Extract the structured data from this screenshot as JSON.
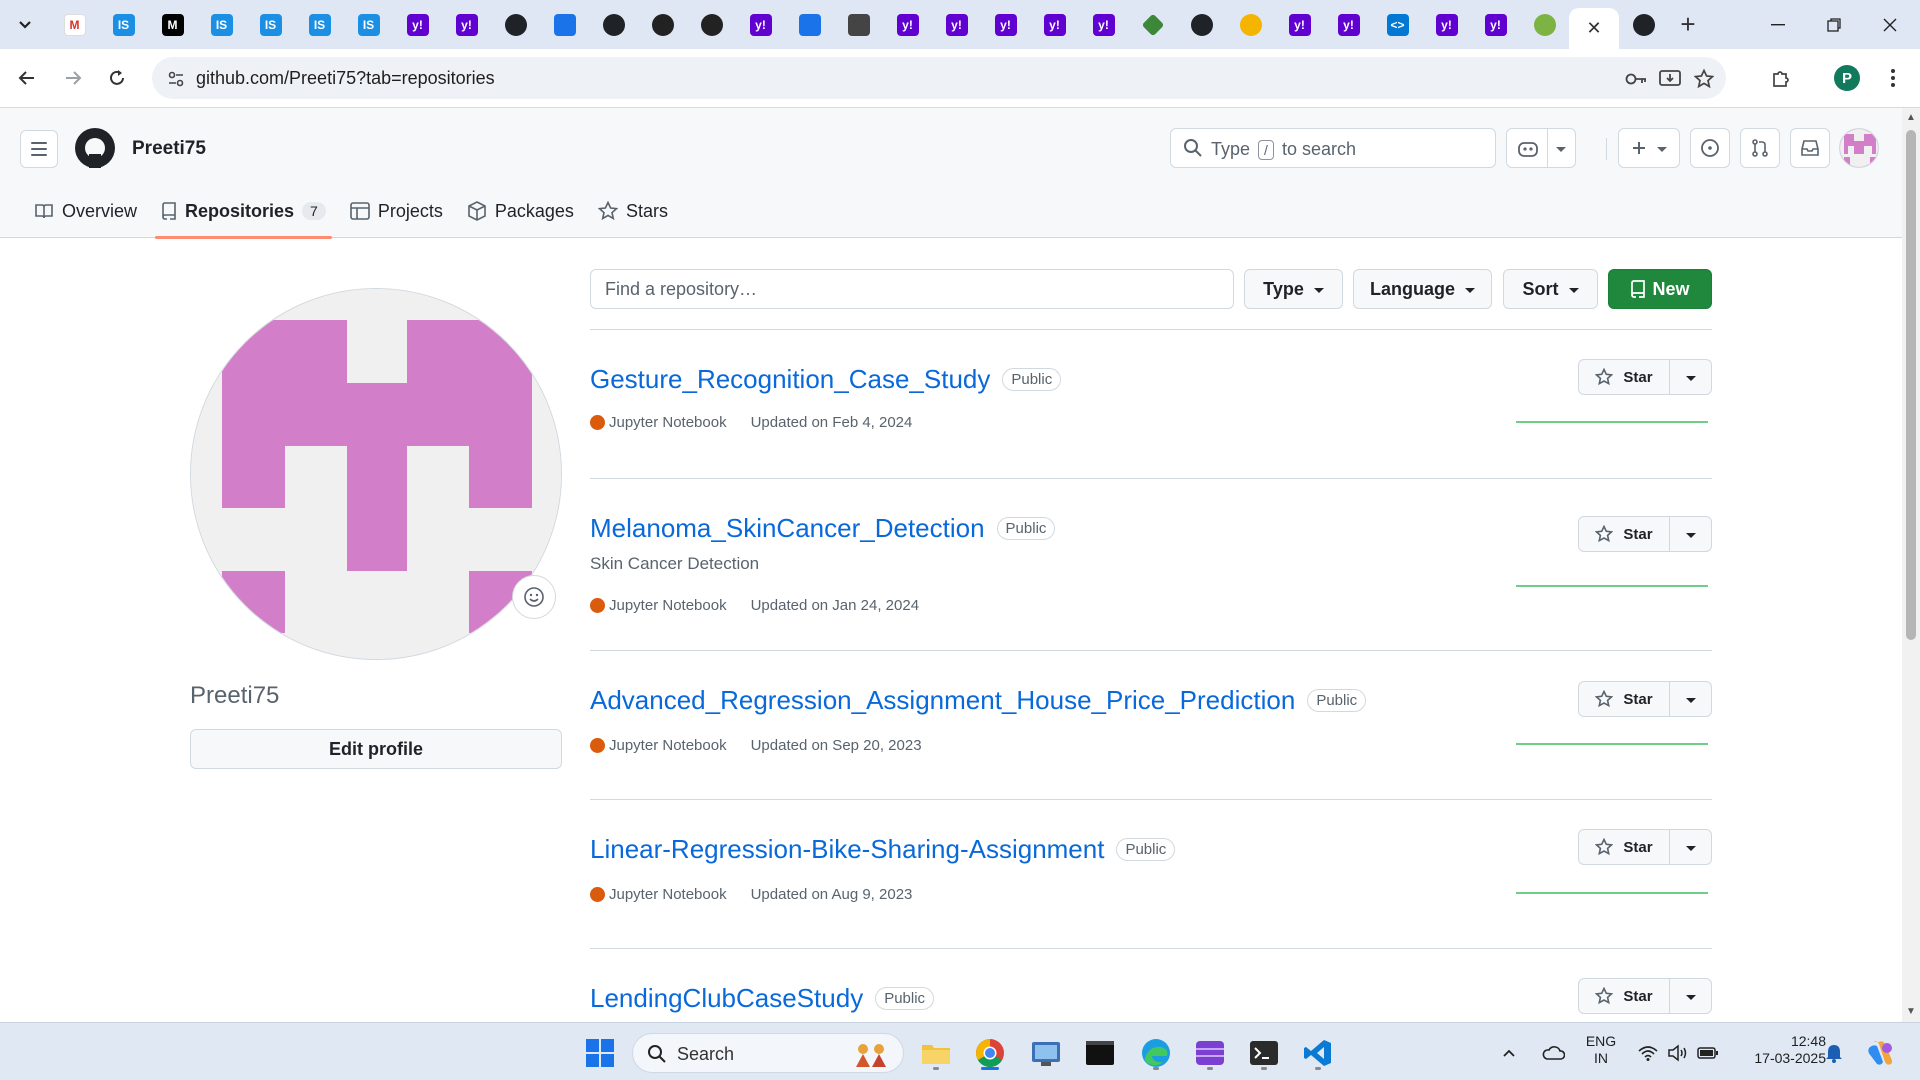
{
  "browser": {
    "url": "github.com/Preeti75?tab=repositories",
    "active_tab_close": "✕",
    "new_tab": "+",
    "tab_favicons": [
      "gmail-icon",
      "is-icon",
      "medium-icon",
      "is-icon",
      "is-icon",
      "is-icon",
      "is-icon",
      "yahoo-icon",
      "yahoo-icon",
      "github-icon",
      "calendar-icon",
      "github-icon",
      "openai-icon",
      "openai-icon",
      "yahoo-icon",
      "calendar-icon",
      "perplexity-icon",
      "yahoo-icon",
      "yahoo-icon",
      "yahoo-icon",
      "yahoo-icon",
      "yahoo-icon",
      "node-icon",
      "github-icon",
      "bulb-icon",
      "yahoo-icon",
      "yahoo-icon",
      "vscode-icon",
      "yahoo-icon",
      "yahoo-icon",
      "green-icon"
    ],
    "profile_initial": "P"
  },
  "github": {
    "username": "Preeti75",
    "search_prefix": "Type",
    "search_key": "/",
    "search_suffix": "to search",
    "nav": [
      {
        "label": "Overview",
        "icon": "book-icon"
      },
      {
        "label": "Repositories",
        "icon": "repo-icon",
        "count": "7"
      },
      {
        "label": "Projects",
        "icon": "table-icon"
      },
      {
        "label": "Packages",
        "icon": "package-icon"
      },
      {
        "label": "Stars",
        "icon": "star-icon"
      }
    ]
  },
  "profile": {
    "name": "Preeti75",
    "edit_label": "Edit profile"
  },
  "filters": {
    "find_placeholder": "Find a repository…",
    "type_label": "Type",
    "language_label": "Language",
    "sort_label": "Sort",
    "new_label": "New"
  },
  "repos": [
    {
      "name": "Gesture_Recognition_Case_Study",
      "visibility": "Public",
      "description": "",
      "language": "Jupyter Notebook",
      "updated": "Updated on Feb 4, 2024",
      "star_label": "Star"
    },
    {
      "name": "Melanoma_SkinCancer_Detection",
      "visibility": "Public",
      "description": "Skin Cancer Detection",
      "language": "Jupyter Notebook",
      "updated": "Updated on Jan 24, 2024",
      "star_label": "Star"
    },
    {
      "name": "Advanced_Regression_Assignment_House_Price_Prediction",
      "visibility": "Public",
      "description": "",
      "language": "Jupyter Notebook",
      "updated": "Updated on Sep 20, 2023",
      "star_label": "Star"
    },
    {
      "name": "Linear-Regression-Bike-Sharing-Assignment",
      "visibility": "Public",
      "description": "",
      "language": "Jupyter Notebook",
      "updated": "Updated on Aug 9, 2023",
      "star_label": "Star"
    },
    {
      "name": "LendingClubCaseStudy",
      "visibility": "Public",
      "description": "",
      "language": "",
      "updated": "",
      "star_label": "Star"
    }
  ],
  "colors": {
    "accent_green": "#1f883d",
    "link_blue": "#0969da",
    "jupyter_orange": "#da5b0b",
    "avatar_pink": "#d37ec8",
    "tab_underline": "#fd8c73"
  },
  "taskbar": {
    "search_label": "Search",
    "lang_line1": "ENG",
    "lang_line2": "IN",
    "time": "12:48",
    "date": "17-03-2025"
  }
}
